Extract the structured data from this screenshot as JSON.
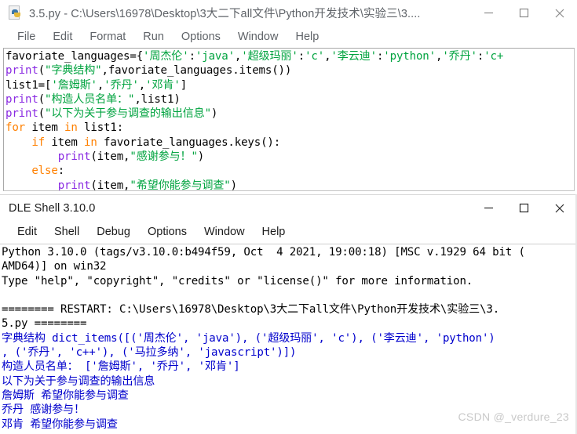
{
  "editor": {
    "icon": "python-file-icon",
    "title": "3.5.py - C:\\Users\\16978\\Desktop\\3大二下all文件\\Python开发技术\\实验三\\3....",
    "menu": [
      "File",
      "Edit",
      "Format",
      "Run",
      "Options",
      "Window",
      "Help"
    ],
    "window_controls": [
      "minimize-icon",
      "maximize-icon",
      "close-icon"
    ],
    "code_lines": [
      [
        {
          "t": "favoriate_languages={",
          "c": "plain"
        },
        {
          "t": "'周杰伦'",
          "c": "str"
        },
        {
          "t": ":",
          "c": "plain"
        },
        {
          "t": "'java'",
          "c": "str"
        },
        {
          "t": ",",
          "c": "plain"
        },
        {
          "t": "'超级玛丽'",
          "c": "str"
        },
        {
          "t": ":",
          "c": "plain"
        },
        {
          "t": "'c'",
          "c": "str"
        },
        {
          "t": ",",
          "c": "plain"
        },
        {
          "t": "'李云迪'",
          "c": "str"
        },
        {
          "t": ":",
          "c": "plain"
        },
        {
          "t": "'python'",
          "c": "str"
        },
        {
          "t": ",",
          "c": "plain"
        },
        {
          "t": "'乔丹'",
          "c": "str"
        },
        {
          "t": ":",
          "c": "plain"
        },
        {
          "t": "'c+",
          "c": "str"
        }
      ],
      [
        {
          "t": "print",
          "c": "fn"
        },
        {
          "t": "(",
          "c": "plain"
        },
        {
          "t": "\"字典结构\"",
          "c": "str"
        },
        {
          "t": ",favoriate_languages.items())",
          "c": "plain"
        }
      ],
      [
        {
          "t": "list1=[",
          "c": "plain"
        },
        {
          "t": "'詹姆斯'",
          "c": "str"
        },
        {
          "t": ",",
          "c": "plain"
        },
        {
          "t": "'乔丹'",
          "c": "str"
        },
        {
          "t": ",",
          "c": "plain"
        },
        {
          "t": "'邓肯'",
          "c": "str"
        },
        {
          "t": "]",
          "c": "plain"
        }
      ],
      [
        {
          "t": "print",
          "c": "fn"
        },
        {
          "t": "(",
          "c": "plain"
        },
        {
          "t": "\"构造人员名单：\"",
          "c": "str"
        },
        {
          "t": ",list1)",
          "c": "plain"
        }
      ],
      [
        {
          "t": "print",
          "c": "fn"
        },
        {
          "t": "(",
          "c": "plain"
        },
        {
          "t": "\"以下为关于参与调查的输出信息\"",
          "c": "str"
        },
        {
          "t": ")",
          "c": "plain"
        }
      ],
      [
        {
          "t": "for",
          "c": "kw"
        },
        {
          "t": " item ",
          "c": "plain"
        },
        {
          "t": "in",
          "c": "kw"
        },
        {
          "t": " list1:",
          "c": "plain"
        }
      ],
      [
        {
          "t": "    ",
          "c": "plain"
        },
        {
          "t": "if",
          "c": "kw"
        },
        {
          "t": " item ",
          "c": "plain"
        },
        {
          "t": "in",
          "c": "kw"
        },
        {
          "t": " favoriate_languages.keys():",
          "c": "plain"
        }
      ],
      [
        {
          "t": "        ",
          "c": "plain"
        },
        {
          "t": "print",
          "c": "fn"
        },
        {
          "t": "(item,",
          "c": "plain"
        },
        {
          "t": "\"感谢参与！\"",
          "c": "str"
        },
        {
          "t": ")",
          "c": "plain"
        }
      ],
      [
        {
          "t": "    ",
          "c": "plain"
        },
        {
          "t": "else",
          "c": "kw"
        },
        {
          "t": ":",
          "c": "plain"
        }
      ],
      [
        {
          "t": "        ",
          "c": "plain"
        },
        {
          "t": "print",
          "c": "fn"
        },
        {
          "t": "(item,",
          "c": "plain"
        },
        {
          "t": "\"希望你能参与调查\"",
          "c": "str"
        },
        {
          "t": ")",
          "c": "plain"
        }
      ]
    ]
  },
  "shell": {
    "title": "DLE Shell 3.10.0",
    "menu": [
      "Edit",
      "Shell",
      "Debug",
      "Options",
      "Window",
      "Help"
    ],
    "window_controls": [
      "minimize-icon",
      "maximize-icon",
      "close-icon"
    ],
    "lines": [
      {
        "t": "Python 3.10.0 (tags/v3.10.0:b494f59, Oct  4 2021, 19:00:18) [MSC v.1929 64 bit (",
        "k": "sys"
      },
      {
        "t": "AMD64)] on win32",
        "k": "sys"
      },
      {
        "t": "Type \"help\", \"copyright\", \"credits\" or \"license()\" for more information.",
        "k": "sys"
      },
      {
        "t": "",
        "k": "blank"
      },
      {
        "t": "======== RESTART: C:\\Users\\16978\\Desktop\\3大二下all文件\\Python开发技术\\实验三\\3.",
        "k": "sys"
      },
      {
        "t": "5.py ========",
        "k": "sys"
      },
      {
        "t": "字典结构 dict_items([('周杰伦', 'java'), ('超级玛丽', 'c'), ('李云迪', 'python')",
        "k": "out"
      },
      {
        "t": ", ('乔丹', 'c++'), ('马拉多纳', 'javascript')])",
        "k": "out"
      },
      {
        "t": "构造人员名单： ['詹姆斯', '乔丹', '邓肯']",
        "k": "out"
      },
      {
        "t": "以下为关于参与调查的输出信息",
        "k": "out"
      },
      {
        "t": "詹姆斯 希望你能参与调查",
        "k": "out"
      },
      {
        "t": "乔丹 感谢参与！",
        "k": "out"
      },
      {
        "t": "邓肯 希望你能参与调查",
        "k": "out"
      }
    ]
  },
  "watermark": {
    "text": "CSDN @_verdure_23"
  },
  "colors": {
    "string": "#00a33f",
    "function": "#8a2be2",
    "keyword": "#ff8000",
    "output": "#0000cc",
    "title_gray": "#5f6368"
  }
}
